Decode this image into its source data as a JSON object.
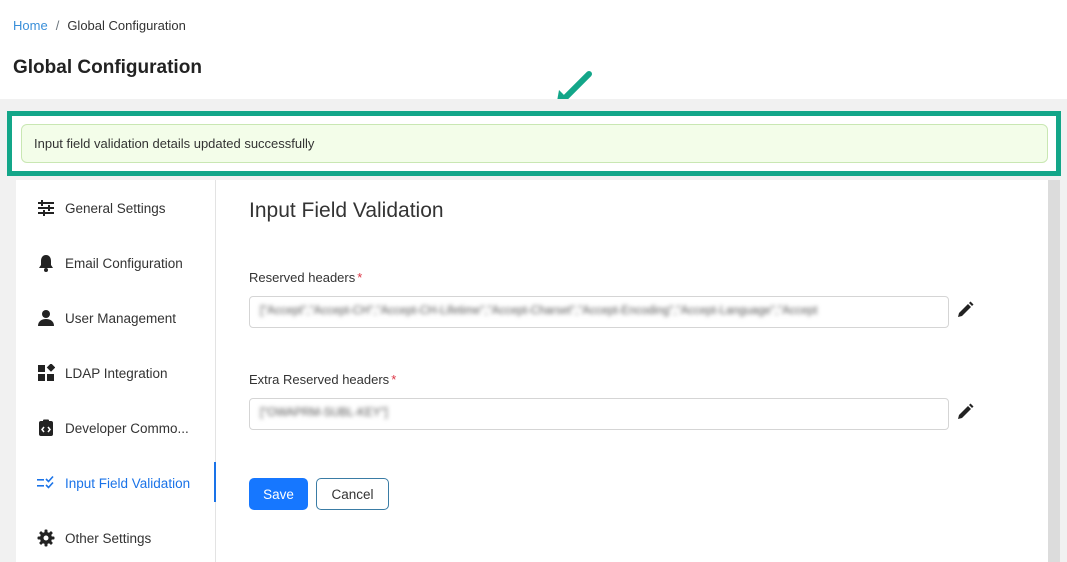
{
  "breadcrumb": {
    "home": "Home",
    "separator": "/",
    "current": "Global Configuration"
  },
  "page": {
    "title": "Global Configuration"
  },
  "alert": {
    "message": "Input field validation details updated successfully"
  },
  "highlight": {
    "color": "#13a689"
  },
  "sidebar": {
    "items": [
      {
        "label": "General Settings",
        "icon": "sliders-icon"
      },
      {
        "label": "Email Configuration",
        "icon": "bell-icon"
      },
      {
        "label": "User Management",
        "icon": "user-icon"
      },
      {
        "label": "LDAP Integration",
        "icon": "grid-icon"
      },
      {
        "label": "Developer Commo...",
        "icon": "clipboard-code-icon"
      },
      {
        "label": "Input Field Validation",
        "icon": "list-check-icon",
        "active": true
      },
      {
        "label": "Other Settings",
        "icon": "gear-icon"
      }
    ],
    "active_color": "#1a73e8"
  },
  "main": {
    "title": "Input Field Validation",
    "fields": [
      {
        "label": "Reserved headers",
        "required_mark": "*",
        "value": "[\"Accept\",\"Accept-CH\",\"Accept-CH-Lifetime\",\"Accept-Charset\",\"Accept-Encoding\",\"Accept-Language\",\"Accept"
      },
      {
        "label": "Extra Reserved headers",
        "required_mark": "*",
        "value": "[\"OWAPRM-SUBL-KEY\"]"
      }
    ],
    "buttons": {
      "save": "Save",
      "cancel": "Cancel"
    }
  }
}
